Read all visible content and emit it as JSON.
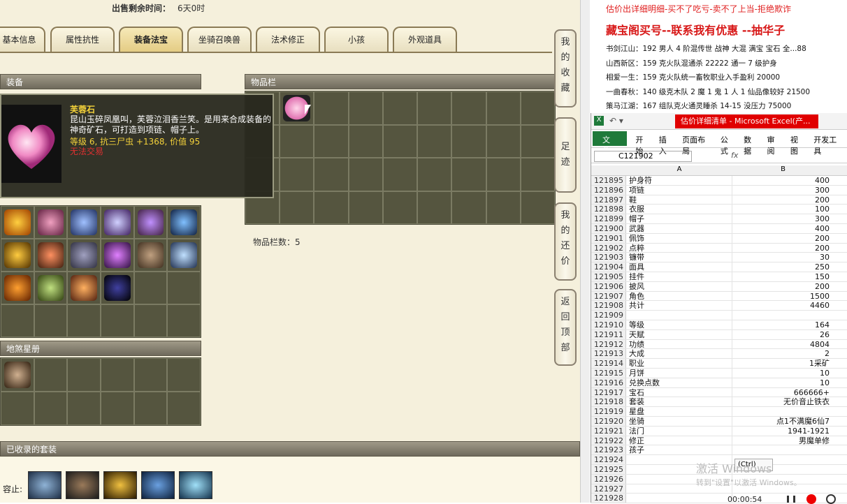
{
  "game": {
    "sale_label": "出售剩余时间：",
    "sale_value": "6天0时",
    "tabs": [
      "基本信息",
      "属性抗性",
      "装备法宝",
      "坐骑召唤兽",
      "法术修正",
      "小孩",
      "外观道具"
    ],
    "equip_header": "装备",
    "items_header": "物品栏",
    "items_count": "物品栏数：5",
    "tooltip": {
      "name": "芙蓉石",
      "desc": "昆山玉碎凤凰叫，芙蓉泣泪香兰笑。是用来合成装备的神奇矿石，可打造到项链、帽子上。",
      "stats": "等级 6, 抗三尸虫 +1368, 价值 95",
      "trade": "无法交易"
    },
    "tianji_header": "地煞星册",
    "collected_header": "已收录的套装",
    "collected_label": "容止:",
    "side_buttons": [
      "我的收藏",
      "足迹",
      "我的还价",
      "返回顶部"
    ],
    "colors": {
      "accent": "#e4cc84",
      "name": "#f4d23a",
      "trade": "#e03030"
    }
  },
  "overlay": {
    "line1": "估价出详细明细-买不了吃亏-卖不了上当-拒绝欺诈",
    "line2": "藏宝阁买号--联系我有优惠 --抽华子",
    "entries": [
      "书剑江山：192 男人 4 阶混传世 战神 大混 满宝 宝石 全...88",
      "山西新区：159 克火队混通杀 22222 通一 7 级护身",
      "相爱一生：159 克火队统一畜牧职业入手盈利 20000",
      "一曲春秋：140 级克木队 2 魔 1 鬼 1 人 1 仙品像较好 21500",
      "策马江湖：167 组队克火通灵睡杀 14-15 没压力 75000"
    ]
  },
  "excel": {
    "title": "估价详细清单 - Microsoft Excel(产...",
    "ribbon": [
      "文件",
      "开始",
      "插入",
      "页面布局",
      "公式",
      "数据",
      "审阅",
      "视图",
      "开发工具"
    ],
    "namebox": "C121902",
    "fx": "fx",
    "col_a": "A",
    "col_b": "B",
    "rows": [
      [
        "121895",
        "护身符",
        "400"
      ],
      [
        "121896",
        "项链",
        "300"
      ],
      [
        "121897",
        "鞋",
        "200"
      ],
      [
        "121898",
        "衣服",
        "100"
      ],
      [
        "121899",
        "帽子",
        "300"
      ],
      [
        "121900",
        "武器",
        "400"
      ],
      [
        "121901",
        "佩饰",
        "200"
      ],
      [
        "121902",
        "点粹",
        "200"
      ],
      [
        "121903",
        "镰带",
        "30"
      ],
      [
        "121904",
        "面具",
        "250"
      ],
      [
        "121905",
        "挂件",
        "150"
      ],
      [
        "121906",
        "披风",
        "200"
      ],
      [
        "121907",
        "角色",
        "1500"
      ],
      [
        "121908",
        "共计",
        "4460"
      ],
      [
        "121909",
        "",
        ""
      ],
      [
        "121910",
        "等级",
        "164"
      ],
      [
        "121911",
        "天赋",
        "26"
      ],
      [
        "121912",
        "功绩",
        "4804"
      ],
      [
        "121913",
        "大成",
        "2"
      ],
      [
        "121914",
        "职业",
        "1采矿"
      ],
      [
        "121915",
        "月饼",
        "10"
      ],
      [
        "121916",
        "兑换点数",
        "10"
      ],
      [
        "121917",
        "宝石",
        "666666+"
      ],
      [
        "121918",
        "套装",
        "无价音止铁衣"
      ],
      [
        "121919",
        "星盘",
        ""
      ],
      [
        "121920",
        "坐骑",
        "点1不满魔6仙7"
      ],
      [
        "121921",
        "法门",
        "1941-1921"
      ],
      [
        "121922",
        "修正",
        "男魔单修"
      ],
      [
        "121923",
        "孩子",
        ""
      ],
      [
        "121924",
        "",
        ""
      ],
      [
        "121925",
        "",
        ""
      ],
      [
        "121926",
        "",
        ""
      ],
      [
        "121927",
        "",
        ""
      ],
      [
        "121928",
        "",
        ""
      ]
    ],
    "paste": "(Ctrl)",
    "watermark1": "激活 Windows",
    "watermark2": "转到\"设置\"以激活 Windows。",
    "timer": "00:00:54"
  }
}
